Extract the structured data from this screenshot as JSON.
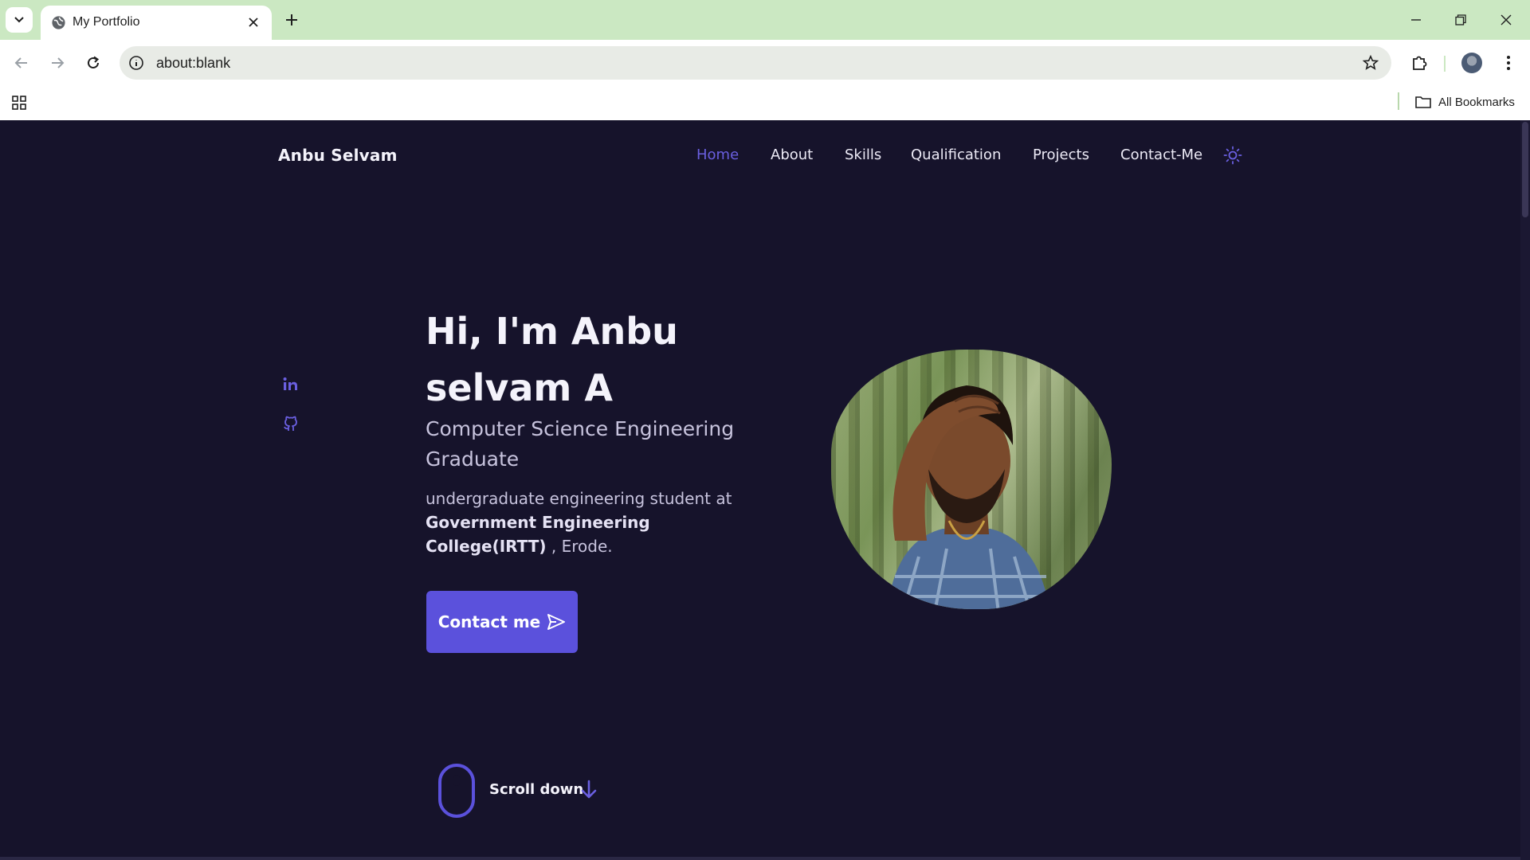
{
  "browser": {
    "tab_title": "My Portfolio",
    "url": "about:blank",
    "bookmarks_label": "All Bookmarks"
  },
  "page": {
    "brand": "Anbu Selvam",
    "nav": [
      "Home",
      "About",
      "Skills",
      "Qualification",
      "Projects",
      "Contact-Me"
    ],
    "active_nav": "Home",
    "hero": {
      "title": "Hi, I'm Anbu selvam A",
      "subtitle": "Computer Science Engineering Graduate",
      "desc_prefix": "undergraduate engineering student at",
      "desc_bold": "Government Engineering College(IRTT)",
      "desc_suffix": " , Erode.",
      "button_label": "Contact me"
    },
    "scroll_label": "Scroll down",
    "colors": {
      "accent": "#5b51dc",
      "background": "#16132b"
    },
    "icons": [
      "linkedin-icon",
      "github-icon",
      "sun-icon",
      "send-icon",
      "mouse-icon",
      "arrow-down-icon"
    ]
  }
}
